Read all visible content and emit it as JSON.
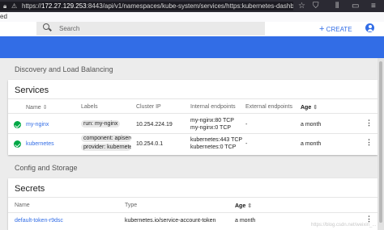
{
  "browser": {
    "url_prefix": "https://",
    "url_host": "172.27.129.253",
    "url_rest": ":8443/api/v1/namespaces/kube-system/services/https:kubernetes-dashb",
    "tab_title": "ed"
  },
  "header": {
    "search_placeholder": "Search",
    "create_label": "CREATE",
    "create_glyph": "+"
  },
  "discovery": {
    "section_title": "Discovery and Load Balancing",
    "card_title": "Services",
    "columns": {
      "name": "Name",
      "labels": "Labels",
      "cluster_ip": "Cluster IP",
      "internal": "Internal endpoints",
      "external": "External endpoints",
      "age": "Age"
    },
    "sort_glyph": "⇕",
    "rows": [
      {
        "name": "my-nginx",
        "labels": [
          "run: my-nginx"
        ],
        "cluster_ip": "10.254.224.19",
        "internal": [
          "my-nginx:80 TCP",
          "my-nginx:0 TCP"
        ],
        "external": "-",
        "age": "a month"
      },
      {
        "name": "kubernetes",
        "labels": [
          "component: apiserv...",
          "provider: kubernetes"
        ],
        "cluster_ip": "10.254.0.1",
        "internal": [
          "kubernetes:443 TCP",
          "kubernetes:0 TCP"
        ],
        "external": "-",
        "age": "a month"
      }
    ]
  },
  "config": {
    "section_title": "Config and Storage",
    "card_title": "Secrets",
    "columns": {
      "name": "Name",
      "type": "Type",
      "age": "Age"
    },
    "rows": [
      {
        "name": "default-token-r9dsc",
        "type": "kubernetes.io/service-account-token",
        "age": "a month"
      }
    ]
  },
  "watermark": "https://blog.csdn.net/weixin_...",
  "colors": {
    "brand": "#326de6",
    "success": "#00a846"
  }
}
